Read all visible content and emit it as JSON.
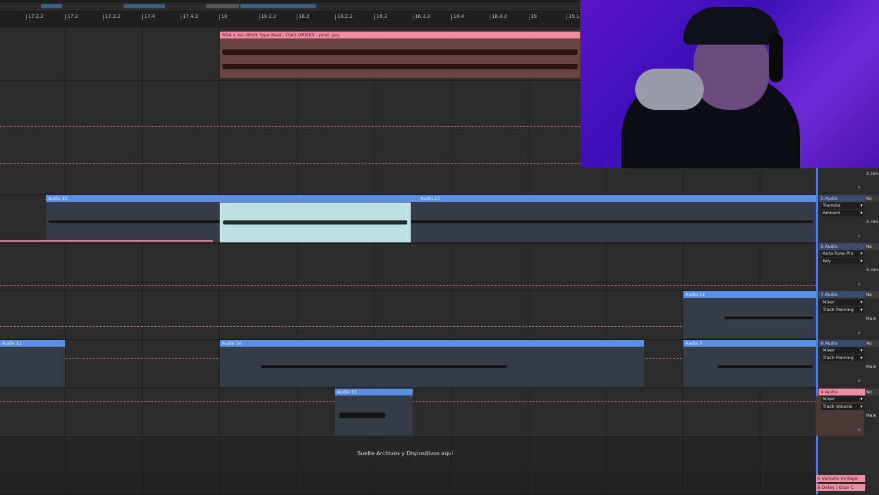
{
  "ruler": {
    "ticks": [
      "17.2.3",
      "17.3",
      "17.3.3",
      "17.4",
      "17.4.3",
      "18",
      "18.1.3",
      "18.2",
      "18.2.3",
      "18.3",
      "18.3.3",
      "18.4",
      "18.4.3",
      "19",
      "19.1"
    ]
  },
  "clips": {
    "top_clip_title": "ROA x Yan Block Type Beat - DIAS GRISES - prod. yey",
    "audio15_left": "Audio 15",
    "audio15_right": "Audio 15",
    "audio11_right": "Audio 11",
    "audio11_left": "Audio 11",
    "audio10": "Audio 10",
    "audio7": "Audio 7",
    "audio15_small": "Audio 15"
  },
  "drop_text": "Suelte Archivos y Dispositivos aquí",
  "tracks": [
    {
      "name": "5 Audio",
      "device": "Tremolo",
      "param": "Amount",
      "input": "No Ing",
      "output": "3-Gro"
    },
    {
      "name": "6 Audio",
      "device": "Auto-Tune Pro",
      "param": "Key",
      "input": "No Ing",
      "output": "3-Gro"
    },
    {
      "name": "7 Audio",
      "device": "Mixer",
      "param": "Track Panning",
      "input": "No Ing",
      "output": "Main"
    },
    {
      "name": "8 Audio",
      "device": "Mixer",
      "param": "Track Panning",
      "input": "No Ing",
      "output": "Main"
    },
    {
      "name": "9 Audio",
      "device": "Mixer",
      "param": "Track Volume",
      "input": "No Ing",
      "output": "Main"
    }
  ],
  "top_outputs": [
    "3-Gro",
    "3-Gro"
  ],
  "returns": [
    "A Valhalla Vintage",
    "B Delay | Glue C"
  ],
  "colors": {
    "clip_blue": "#5b8fe6",
    "clip_pink": "#f08ca4",
    "webcam_purple": "#5a14c8"
  }
}
